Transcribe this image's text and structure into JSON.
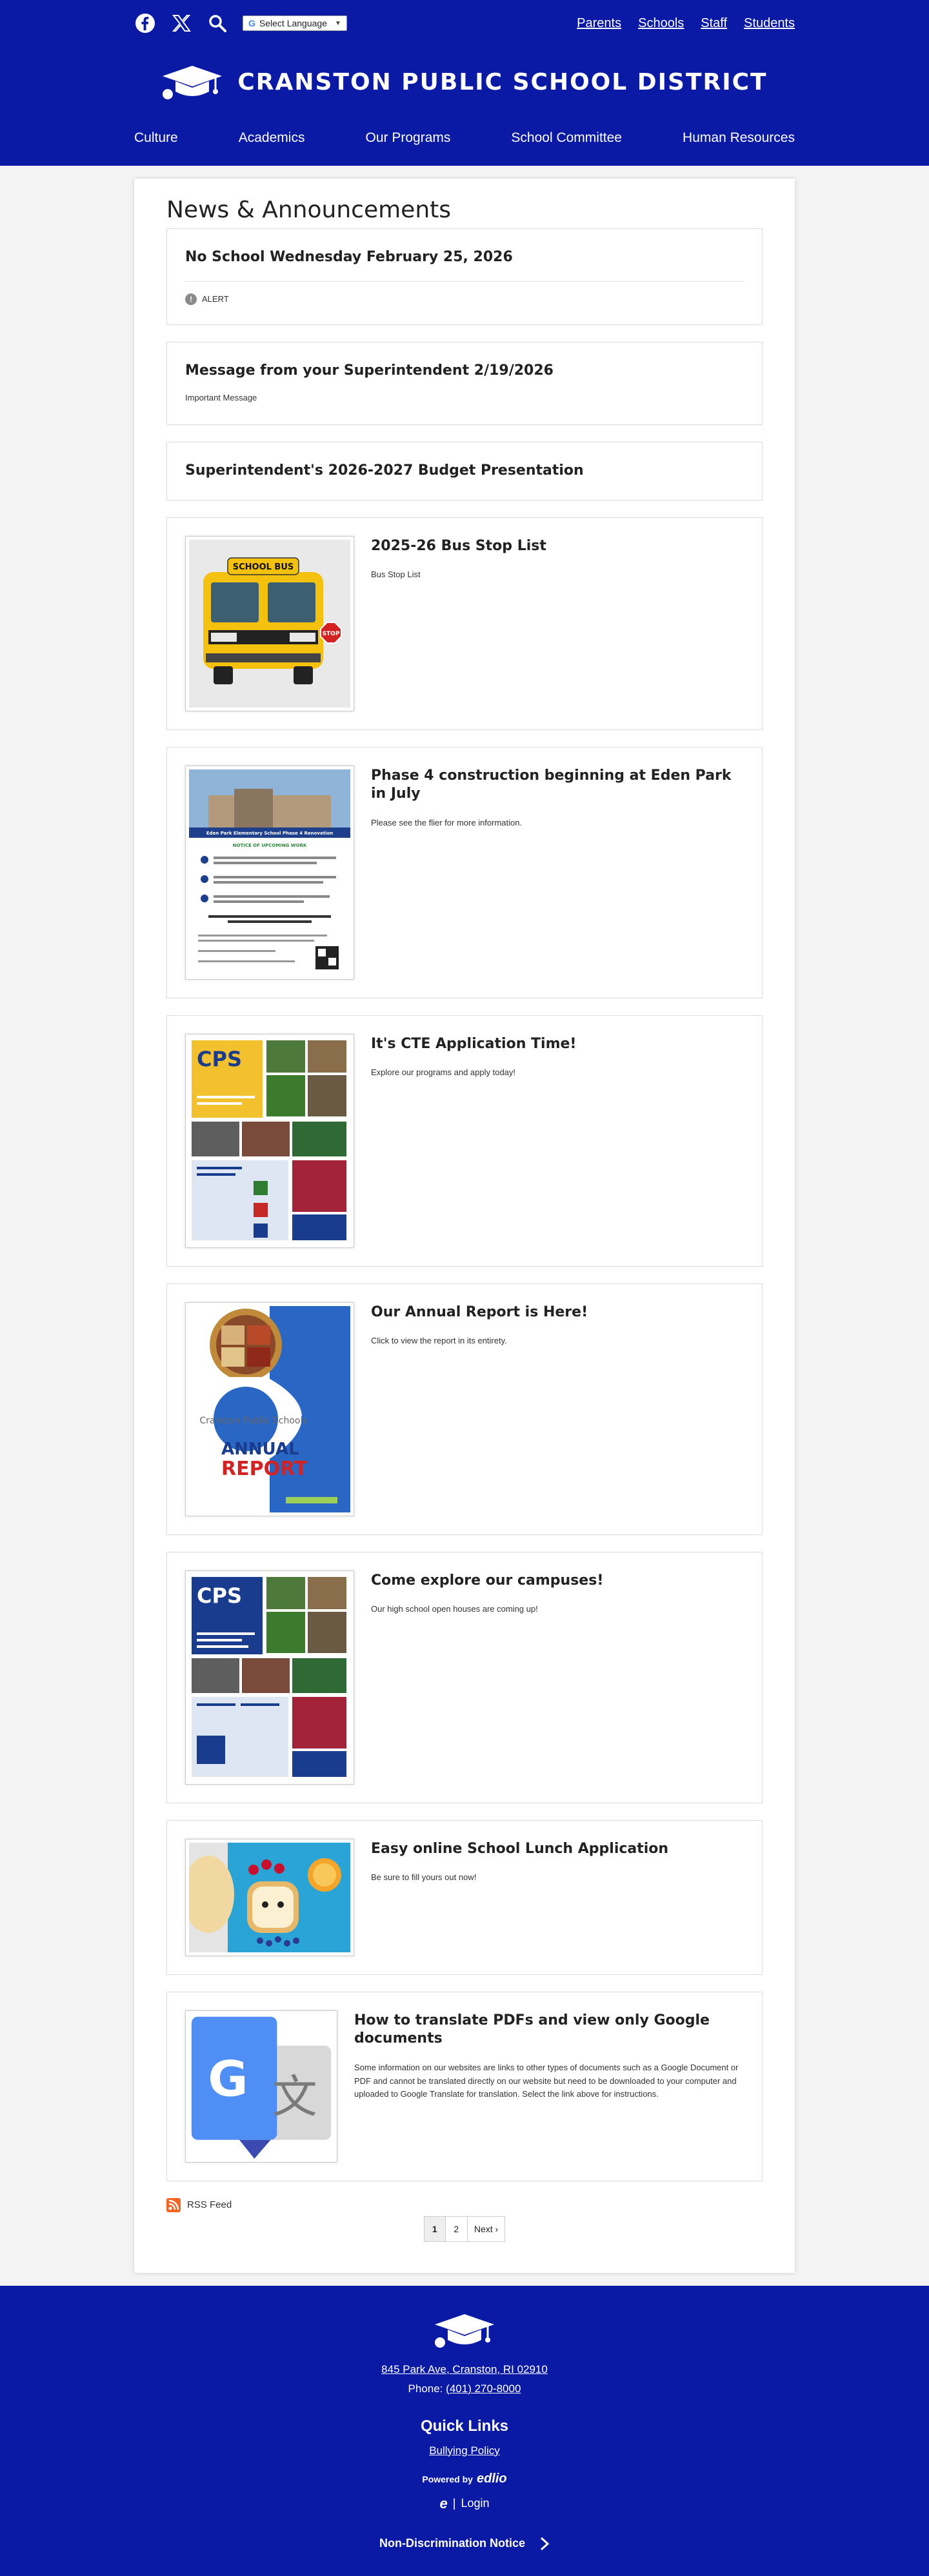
{
  "header": {
    "language_label": "Select Language",
    "top_links": [
      "Parents",
      "Schools",
      "Staff",
      "Students"
    ],
    "district_name": "CRANSTON PUBLIC SCHOOL DISTRICT",
    "nav": [
      "Culture",
      "Academics",
      "Our Programs",
      "School Committee",
      "Human Resources"
    ]
  },
  "main": {
    "title": "News & Announcements",
    "news": [
      {
        "title": "No School Wednesday February 25, 2026",
        "tag": "ALERT"
      },
      {
        "title": "Message from your Superintendent 2/19/2026",
        "summary": "Important Message"
      },
      {
        "title": "Superintendent's 2026-2027 Budget Presentation"
      },
      {
        "title": "2025-26 Bus Stop List",
        "summary": "Bus Stop List",
        "image_text": [
          "SCHOOL BUS",
          "STOP"
        ]
      },
      {
        "title": "Phase 4 construction beginning at Eden Park in July",
        "summary": "Please see the flier for more information.",
        "image_text": [
          "Eden Park Elementary School Phase 4 Renovation",
          "NOTICE OF UPCOMING WORK"
        ]
      },
      {
        "title": "It's CTE Application Time!",
        "summary": "Explore our programs and apply today!",
        "image_text": [
          "CPS"
        ]
      },
      {
        "title": "Our Annual Report is Here!",
        "summary": "Click to view the report in its entirety.",
        "image_text": [
          "Cranston Public Schools",
          "ANNUAL",
          "REPORT"
        ]
      },
      {
        "title": "Come explore our campuses!",
        "summary": "Our high school open houses are coming up!",
        "image_text": [
          "CPS"
        ]
      },
      {
        "title": "Easy online School Lunch Application",
        "summary": "Be sure to fill yours out now!"
      },
      {
        "title": "How to translate PDFs and view only Google documents",
        "summary": "Some information on our websites are links to other types of documents such as a Google Document or PDF and cannot be translated directly on our website but need to be downloaded to your computer and uploaded to Google Translate for translation. Select the link above for instructions."
      }
    ],
    "rss_label": "RSS Feed",
    "pagination": [
      "1",
      "2",
      "Next ›"
    ]
  },
  "footer": {
    "address": "845 Park Ave, Cranston, RI 02910",
    "phone_label": "Phone:",
    "phone": "(401) 270-8000",
    "quick_links_title": "Quick Links",
    "quick_links": [
      "Bullying Policy"
    ],
    "powered_by": "Powered by",
    "powered_brand": "edlio",
    "login": "Login",
    "non_discrimination": "Non-Discrimination Notice"
  },
  "colors": {
    "brand_blue": "#0a1aa4",
    "rss_orange": "#f26522"
  },
  "icons": [
    "facebook-icon",
    "x-twitter-icon",
    "search-icon",
    "graduation-cap-icon",
    "rss-icon",
    "edlio-icon",
    "chevron-right-icon",
    "alert-icon"
  ]
}
